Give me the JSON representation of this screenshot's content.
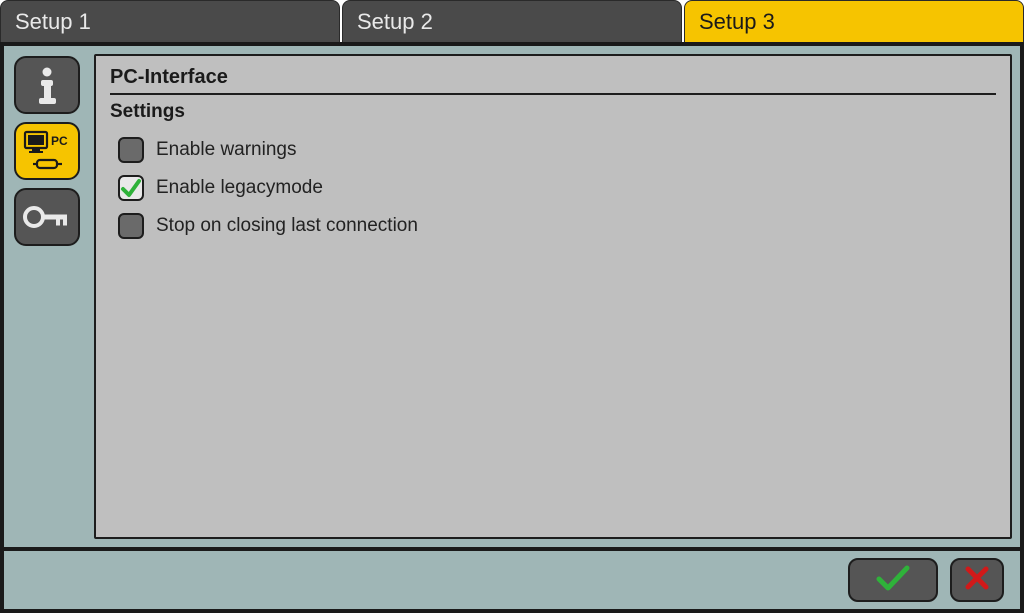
{
  "tabs": [
    {
      "label": "Setup 1",
      "active": false
    },
    {
      "label": "Setup 2",
      "active": false
    },
    {
      "label": "Setup 3",
      "active": true
    }
  ],
  "sidebar": {
    "items": [
      {
        "name": "info",
        "active": false
      },
      {
        "name": "pc-interface",
        "label": "PC",
        "active": true
      },
      {
        "name": "key",
        "active": false
      }
    ]
  },
  "panel": {
    "title": "PC-Interface",
    "subtitle": "Settings",
    "options": [
      {
        "label": "Enable warnings",
        "checked": false
      },
      {
        "label": "Enable legacymode",
        "checked": true
      },
      {
        "label": "Stop on closing last connection",
        "checked": false
      }
    ]
  },
  "footer": {
    "confirm": "ok",
    "cancel": "cancel"
  },
  "colors": {
    "accent": "#f6c400",
    "tab_inactive": "#4a4a4a",
    "panel_bg": "#bfbfbf",
    "frame_bg": "#9fb6b6",
    "check_green": "#2fb23a",
    "cancel_red": "#d11919"
  }
}
